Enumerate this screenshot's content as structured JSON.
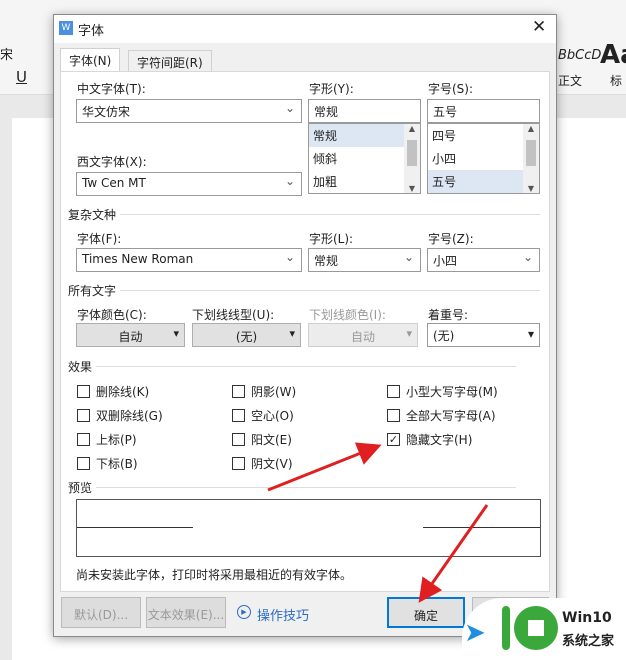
{
  "background": {
    "font_name_fragment": "宋",
    "style_sample": "BbCcD",
    "style_label_1": "正文",
    "style_label_2": "标",
    "style_big": "Aa"
  },
  "dialog": {
    "title": "字体",
    "tabs": [
      {
        "label": "字体(N)",
        "active": true
      },
      {
        "label": "字符间距(R)",
        "active": false
      }
    ],
    "chinese_font": {
      "label": "中文字体(T):",
      "value": "华文仿宋"
    },
    "style": {
      "label": "字形(Y):",
      "value": "常规",
      "options": [
        "常规",
        "倾斜",
        "加粗"
      ],
      "selected": "常规"
    },
    "size": {
      "label": "字号(S):",
      "value": "五号",
      "options": [
        "四号",
        "小四",
        "五号"
      ],
      "selected": "五号"
    },
    "western_font": {
      "label": "西文字体(X):",
      "value": "Tw Cen MT"
    },
    "complex": {
      "section": "复杂文种",
      "font_label": "字体(F):",
      "font_value": "Times New Roman",
      "style_label": "字形(L):",
      "style_value": "常规",
      "size_label": "字号(Z):",
      "size_value": "小四"
    },
    "all_text": {
      "section": "所有文字",
      "color_label": "字体颜色(C):",
      "color_value": "自动",
      "underline_label": "下划线线型(U):",
      "underline_value": "(无)",
      "underline_color_label": "下划线颜色(I):",
      "underline_color_value": "自动",
      "emphasis_label": "着重号:",
      "emphasis_value": "(无)"
    },
    "effects": {
      "section": "效果",
      "items": [
        {
          "label": "删除线(K)",
          "checked": false
        },
        {
          "label": "双删除线(G)",
          "checked": false
        },
        {
          "label": "上标(P)",
          "checked": false
        },
        {
          "label": "下标(B)",
          "checked": false
        },
        {
          "label": "阴影(W)",
          "checked": false
        },
        {
          "label": "空心(O)",
          "checked": false
        },
        {
          "label": "阳文(E)",
          "checked": false
        },
        {
          "label": "阴文(V)",
          "checked": false
        },
        {
          "label": "小型大写字母(M)",
          "checked": false
        },
        {
          "label": "全部大写字母(A)",
          "checked": false
        },
        {
          "label": "隐藏文字(H)",
          "checked": true
        }
      ]
    },
    "preview": {
      "section": "预览"
    },
    "note": "尚未安装此字体，打印时将采用最相近的有效字体。",
    "buttons": {
      "default": "默认(D)...",
      "text_effect": "文本效果(E)...",
      "tips": "操作技巧",
      "ok": "确定"
    }
  },
  "watermark": {
    "line1": "Win10",
    "line2": "系统之家"
  },
  "colors": {
    "accent": "#0078d7",
    "arrow": "#e02020",
    "link": "#2b6cc4"
  }
}
